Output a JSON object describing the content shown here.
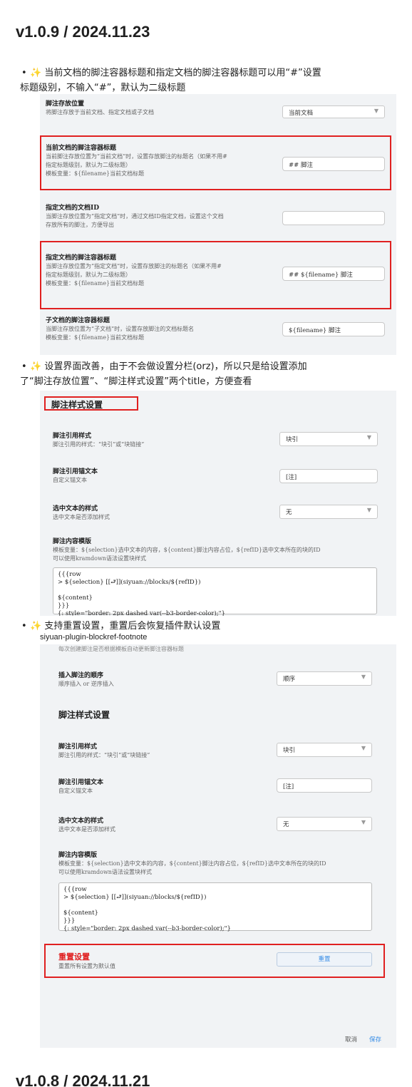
{
  "v109": {
    "heading": "v1.0.9 / 2024.11.23",
    "b1_l1": "当前文档的脚注容器标题和指定文档的脚注容器标题可以用“#”设置",
    "b1_l2": "标题级别，不输入“#”，默认为二级标题",
    "b2_l1": "设置界面改善，由于不会做设置分栏(orz)，所以只是给设置添加",
    "b2_l2": "了“脚注存放位置”、“脚注样式设置”两个title，方便查看",
    "b3": "支持重置设置，重置后会恢复插件默认设置"
  },
  "shot1": {
    "loc_title": "脚注存放位置",
    "loc_desc": "将脚注存放于当前文档、指定文档或子文档",
    "loc_value": "当前文档",
    "cur_title": "当前文档的脚注容器标题",
    "cur_d1": "当前脚注存放位置为“当前文档”时，设置存放脚注的标题名（如果不用#",
    "cur_d2": "指定标题级别，默认为二级标题）",
    "cur_d3": "模板变量：${filename}当前文档标题",
    "cur_value": "## 脚注",
    "doc_title": "指定文档的文档ID",
    "doc_d1": "当脚注存放位置为“指定文档”时，通过文档ID指定文档，设置这个文档",
    "doc_d2": "存放所有的脚注，方便导出",
    "spec_title": "指定文档的脚注容器标题",
    "spec_d1": "当脚注存放位置为“指定文档”时，设置存放脚注的标题名（如果不用#",
    "spec_d2": "指定标题级别，默认为二级标题）",
    "spec_d3": "模板变量：${filename}当前文档标题",
    "spec_value": "## ${filename} 脚注",
    "sub_title": "子文档的脚注容器标题",
    "sub_d1": "当脚注存放位置为“子文档”时，设置存放脚注的文档标题名",
    "sub_d2": "模板变量：${filename}当前文档标题",
    "sub_value": "${filename} 脚注"
  },
  "style": {
    "section": "脚注样式设置",
    "ref_title": "脚注引用样式",
    "ref_desc": "脚注引用的样式：“块引”或“块链接”",
    "ref_value": "块引",
    "anchor_title": "脚注引用锚文本",
    "anchor_desc": "自定义锚文本",
    "anchor_value": "[注]",
    "selstyle_title": "选中文本的样式",
    "selstyle_desc": "选中文本是否添加样式",
    "selstyle_value": "无",
    "tpl_title": "脚注内容模版",
    "tpl_d1": "模板变量：${selection}选中文本的内容，${content}脚注内容占位，${refID}选中文本所在的块的ID",
    "tpl_d2": "可以使用kramdown语法设置块样式",
    "tpl_code": "{{{row\n> ${selection} [[⮐]](siyuan://blocks/${refID})\n\n${content}\n}}}\n{: style=\"border: 2px dashed var(--b3-border-color);\"}"
  },
  "shot3": {
    "plugin": "siyuan-plugin-blockref-footnote",
    "cut_desc": "每次创建脚注是否根据模板自动更新脚注容器标题",
    "order_title": "插入脚注的顺序",
    "order_desc": "顺序插入 or 逆序插入",
    "order_value": "顺序",
    "reset_title": "重置设置",
    "reset_desc": "重置所有设置为默认值",
    "reset_btn": "重置",
    "cancel": "取消",
    "save": "保存"
  },
  "v108": {
    "heading": "v1.0.8 / 2024.11.21"
  },
  "colors": {
    "highlight": "#e02020",
    "accent": "#3a8ee6",
    "spark": "#f5a623"
  }
}
